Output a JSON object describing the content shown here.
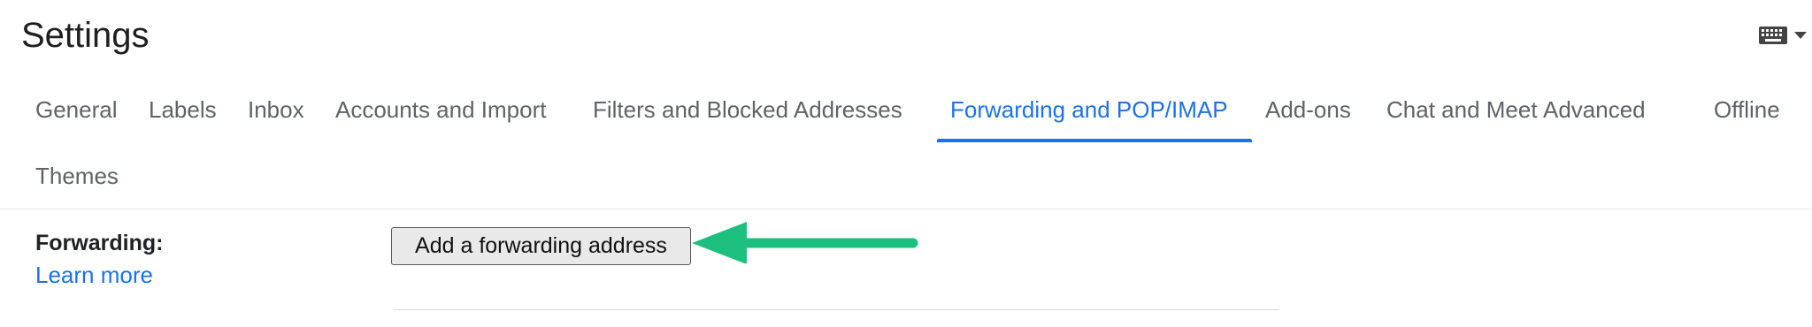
{
  "header": {
    "title": "Settings",
    "input_tools": {
      "icon": "keyboard-icon",
      "dropdown_icon": "caret-down-icon"
    }
  },
  "tabs": [
    {
      "label": "General",
      "active": false
    },
    {
      "label": "Labels",
      "active": false
    },
    {
      "label": "Inbox",
      "active": false
    },
    {
      "label": "Accounts and Import",
      "active": false
    },
    {
      "label": "Filters and Blocked Addresses",
      "active": false
    },
    {
      "label": "Forwarding and POP/IMAP",
      "active": true
    },
    {
      "label": "Add-ons",
      "active": false
    },
    {
      "label": "Chat and Meet",
      "active": false
    },
    {
      "label": "Advanced",
      "active": false
    },
    {
      "label": "Offline",
      "active": false
    },
    {
      "label": "Themes",
      "active": false
    }
  ],
  "forwarding": {
    "label": "Forwarding:",
    "learn_more": "Learn more",
    "add_button": "Add a forwarding address"
  },
  "colors": {
    "accent": "#1a73e8",
    "annotation_arrow": "#1dbf7e",
    "text": "#5f6368"
  }
}
